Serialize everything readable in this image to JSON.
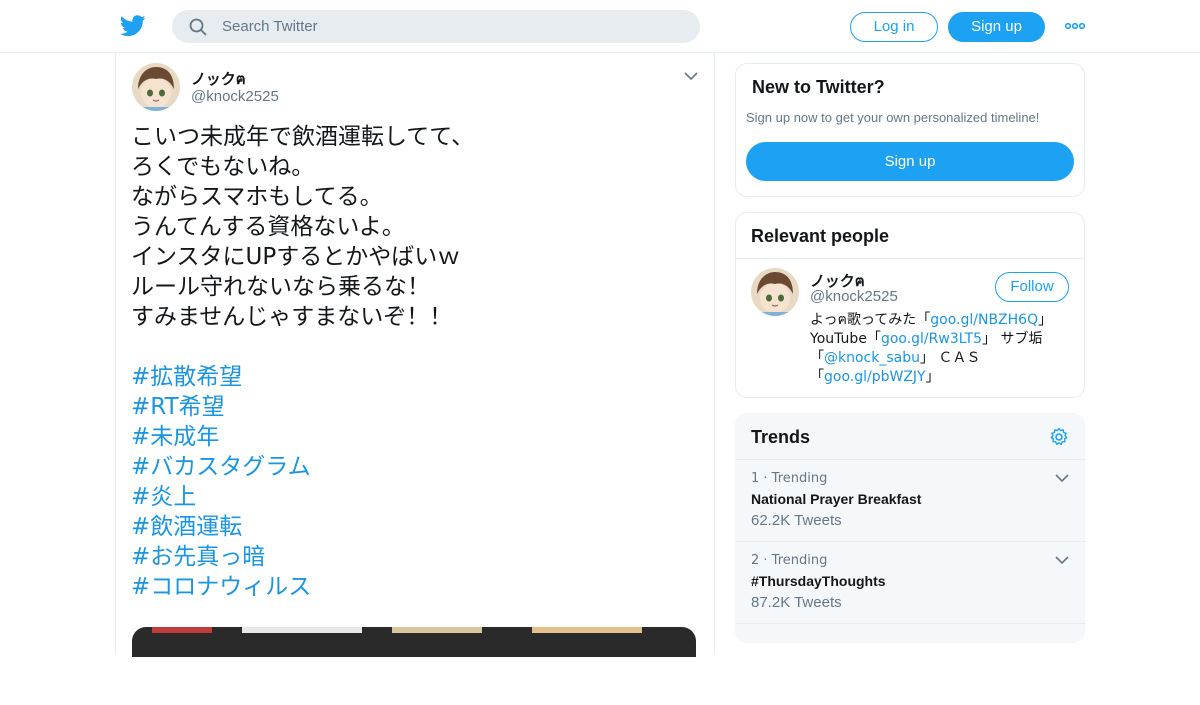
{
  "colors": {
    "brand": "#1da1f2",
    "link": "#1b95e0",
    "secondary_text": "#657786",
    "border": "#e6ecf0",
    "trends_bg": "#f5f8fa"
  },
  "header": {
    "logo_icon": "twitter-bird-icon",
    "search_placeholder": "Search Twitter",
    "search_icon": "search-icon",
    "login_label": "Log in",
    "signup_label": "Sign up",
    "more_icon": "more-dots-icon"
  },
  "tweet": {
    "author_name": "ノックฅ",
    "author_handle": "@knock2525",
    "caret_icon": "chevron-down-icon",
    "lines": [
      "こいつ未成年で飲酒運転してて、",
      "ろくでもないね。",
      "ながらスマホもしてる。",
      "うんてんする資格ないよ。",
      "インスタにUPするとかやばいｗ",
      "ルール守れないなら乗るな！",
      "すみませんじゃすまないぞ！！"
    ],
    "hashtags": [
      "#拡散希望",
      "#RT希望",
      "#未成年",
      "#バカスタグラム",
      "#炎上",
      "#飲酒運転",
      "#お先真っ暗",
      "#コロナウィルス"
    ]
  },
  "new_to_twitter": {
    "title": "New to Twitter?",
    "subtitle": "Sign up now to get your own personalized timeline!",
    "signup_label": "Sign up"
  },
  "relevant_people": {
    "title": "Relevant people",
    "name": "ノックฅ",
    "handle": "@knock2525",
    "follow_label": "Follow",
    "bio": {
      "l1_pre": "よっฅ歌ってみた「",
      "l1_link": "goo.gl/NBZH6Q",
      "l1_post": "」",
      "l2_pre": "YouTube「",
      "l2_link": "goo.gl/Rw3LT5",
      "l2_post": "」 サブ垢",
      "l3_pre": "「",
      "l3_link": "@knock_sabu",
      "l3_post": "」 ＣＡＳ",
      "l4_pre": "「",
      "l4_link": "goo.gl/pbWZJY",
      "l4_post": "」"
    }
  },
  "trends": {
    "title": "Trends",
    "settings_icon": "gear-icon",
    "items": [
      {
        "meta": "1 · Trending",
        "name": "National Prayer Breakfast",
        "count": "62.2K Tweets"
      },
      {
        "meta": "2 · Trending",
        "name": "#ThursdayThoughts",
        "count": "87.2K Tweets"
      }
    ]
  }
}
